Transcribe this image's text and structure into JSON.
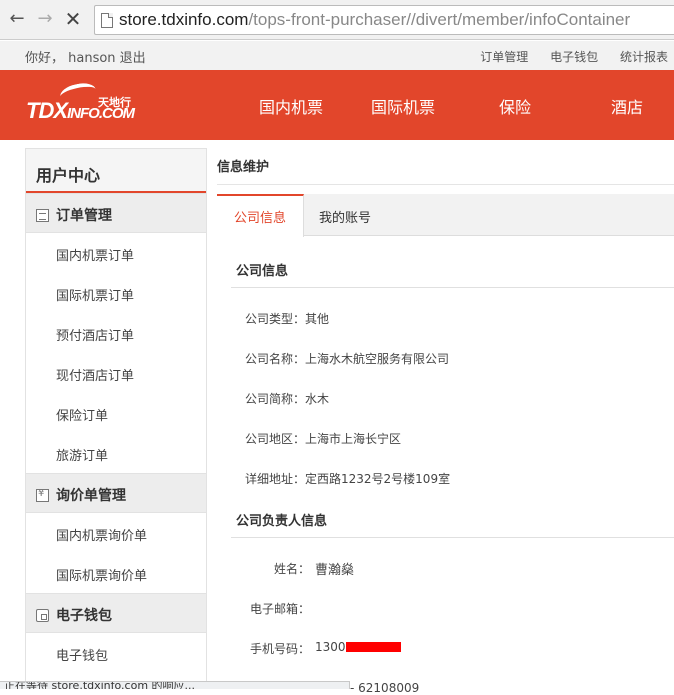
{
  "browser": {
    "url_host": "store.tdxinfo.com",
    "url_path": "/tops-front-purchaser//divert/member/infoContainer"
  },
  "user_bar": {
    "greeting": "你好， hanson 退出",
    "links": [
      "订单管理",
      "电子钱包",
      "统计报表"
    ]
  },
  "header": {
    "logo_text": "TDX",
    "logo_text2": "INFO.COM",
    "logo_cn": "天地行",
    "nav": [
      "国内机票",
      "国际机票",
      "保险",
      "酒店"
    ],
    "bg_color": "#e2462b"
  },
  "sidebar": {
    "title": "用户中心",
    "groups": [
      {
        "label": "订单管理",
        "icon": "list-icon",
        "items": [
          "国内机票订单",
          "国际机票订单",
          "预付酒店订单",
          "现付酒店订单",
          "保险订单",
          "旅游订单"
        ]
      },
      {
        "label": "询价单管理",
        "icon": "yen-icon",
        "items": [
          "国内机票询价单",
          "国际机票询价单"
        ]
      },
      {
        "label": "电子钱包",
        "icon": "wallet-icon",
        "items": [
          "电子钱包"
        ]
      }
    ]
  },
  "main": {
    "breadcrumb": "信息维护",
    "tabs": [
      "公司信息",
      "我的账号"
    ],
    "company_section": {
      "title": "公司信息",
      "fields": [
        "公司类型：其他",
        "公司名称：上海水木航空服务有限公司",
        "公司简称：水木",
        "公司地区：上海市上海长宁区",
        "详细地址：定西路1232号2号楼109室"
      ]
    },
    "contact_section": {
      "title": "公司负责人信息",
      "name_label": "姓名：",
      "name_value": "曹瀚燊",
      "email_label": "电子邮箱：",
      "phone_label": "手机号码：",
      "phone_value": "1300",
      "partial_value": "62108009"
    }
  },
  "status_bar": {
    "text": "正在等待 store.tdxinfo.com 的响应..."
  }
}
